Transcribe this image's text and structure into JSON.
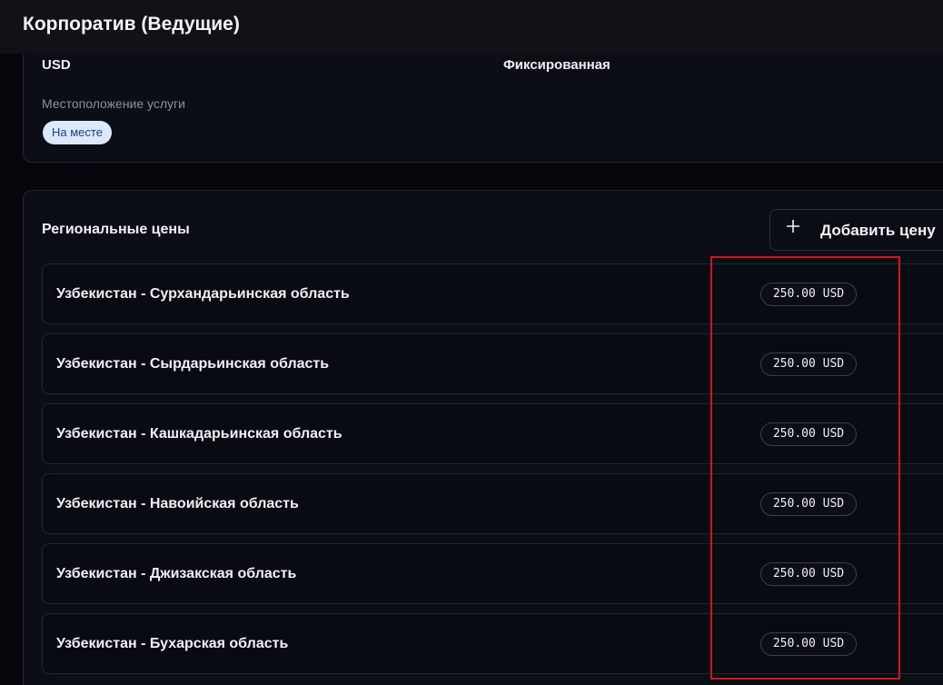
{
  "header": {
    "title": "Корпоратив (Ведущие)"
  },
  "details": {
    "currency": "USD",
    "price_type": "Фиксированная",
    "location_label": "Местоположение услуги",
    "location_value": "На месте"
  },
  "regional_prices": {
    "title": "Региональные цены",
    "add_button_label": "Добавить цену",
    "add_icon": "plus-icon",
    "rows": [
      {
        "region": "Узбекистан - Сурхандарьинская область",
        "price": "250.00 USD"
      },
      {
        "region": "Узбекистан - Сырдарьинская область",
        "price": "250.00 USD"
      },
      {
        "region": "Узбекистан - Кашкадарьинская область",
        "price": "250.00 USD"
      },
      {
        "region": "Узбекистан - Навоийская область",
        "price": "250.00 USD"
      },
      {
        "region": "Узбекистан - Джизакская область",
        "price": "250.00 USD"
      },
      {
        "region": "Узбекистан - Бухарская область",
        "price": "250.00 USD"
      }
    ]
  },
  "colors": {
    "background": "#05070c",
    "card": "#0b0e15",
    "badge_bg": "#dce8fb",
    "badge_text": "#1d3f8c",
    "highlight": "#d3151a"
  }
}
